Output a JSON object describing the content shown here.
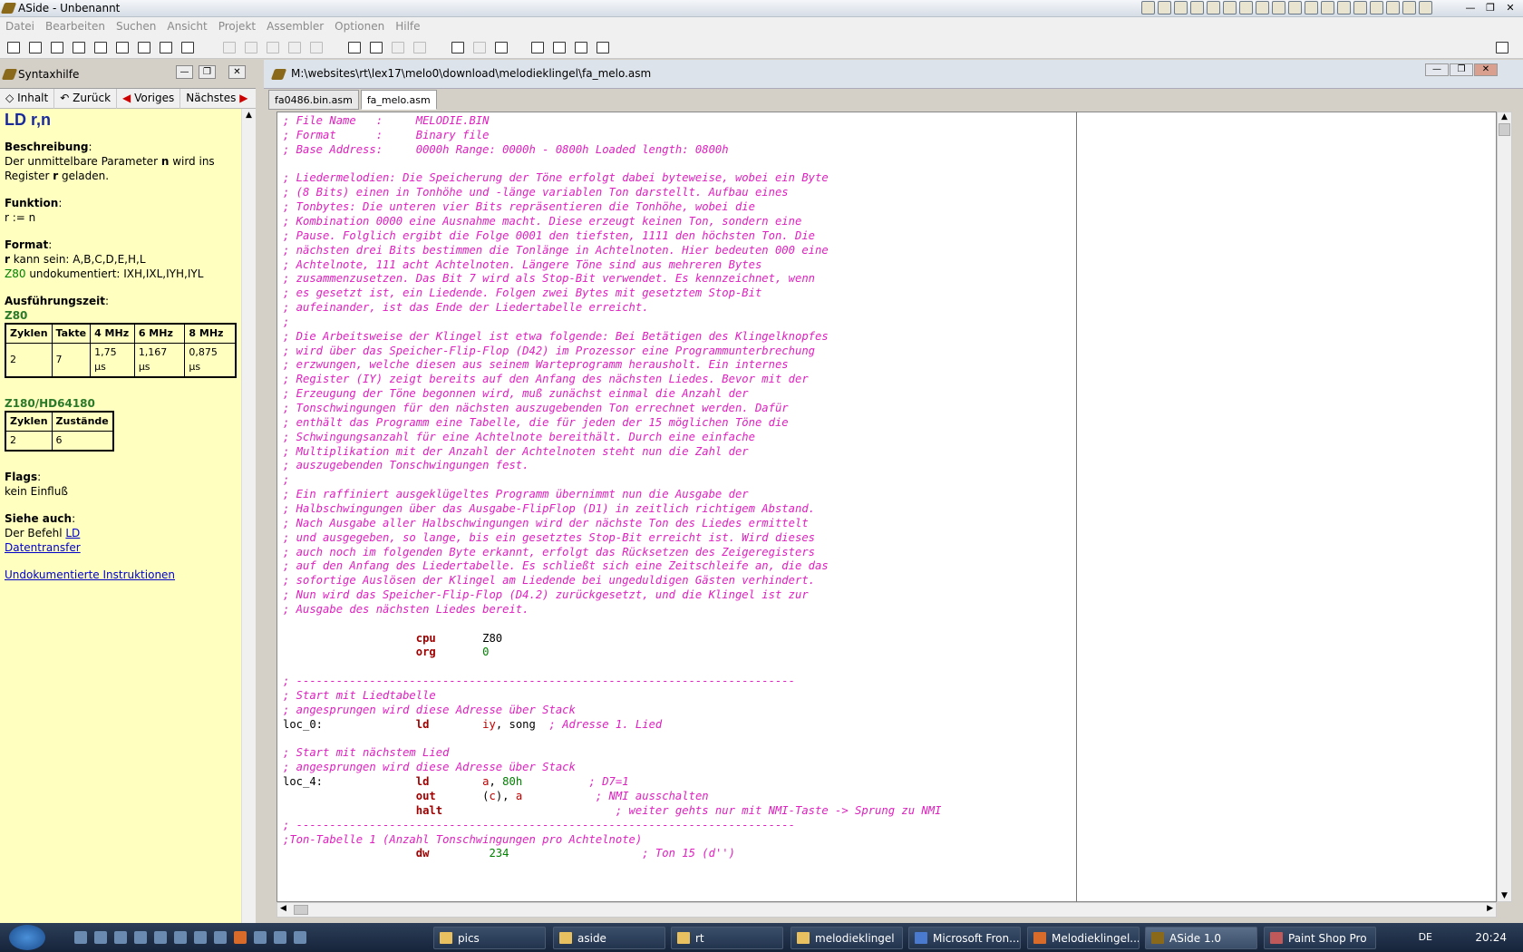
{
  "app": {
    "title": "ASide - Unbenannt"
  },
  "menu": [
    "Datei",
    "Bearbeiten",
    "Suchen",
    "Ansicht",
    "Projekt",
    "Assembler",
    "Optionen",
    "Hilfe"
  ],
  "help": {
    "title": "Syntaxhilfe",
    "nav": {
      "contents": "Inhalt",
      "back": "Zurück",
      "prev": "Voriges",
      "next": "Nächstes"
    },
    "cmd": "LD r,n",
    "desc_h": "Beschreibung",
    "desc_1a": "Der unmittelbare Parameter ",
    "desc_1b": "n",
    "desc_1c": " wird ins",
    "desc_2a": "Register ",
    "desc_2b": "r",
    "desc_2c": " geladen.",
    "func_h": "Funktion",
    "func": "r := n",
    "fmt_h": "Format",
    "fmt_1a": "r",
    "fmt_1b": " kann sein: A,B,C,D,E,H,L",
    "fmt_2a": "Z80",
    "fmt_2b": " undokumentiert: IXH,IXL,IYH,IYL",
    "time_h": "Ausführungszeit",
    "z80": "Z80",
    "z80_table": {
      "headers": [
        "Zyklen",
        "Takte",
        "4 MHz",
        "6 MHz",
        "8 MHz"
      ],
      "row": [
        "2",
        "7",
        "1,75 µs",
        "1,167 µs",
        "0,875 µs"
      ]
    },
    "z180": "Z180/HD64180",
    "z180_table": {
      "headers": [
        "Zyklen",
        "Zustände"
      ],
      "row": [
        "2",
        "6"
      ]
    },
    "flags_h": "Flags",
    "flags": "kein Einfluß",
    "see_h": "Siehe auch",
    "see_1a": "Der Befehl ",
    "see_1b": "LD",
    "see_2": "Datentransfer",
    "undoc": "Undokumentierte Instruktionen"
  },
  "editor": {
    "path": "M:\\websites\\rt\\lex17\\melo0\\download\\melodieklingel\\fa_melo.asm",
    "tabs": [
      "fa0486.bin.asm",
      "fa_melo.asm"
    ],
    "lines": [
      {
        "t": "c",
        "s": "; File Name   :     MELODIE.BIN"
      },
      {
        "t": "c",
        "s": "; Format      :     Binary file"
      },
      {
        "t": "c",
        "s": "; Base Address:     0000h Range: 0000h - 0800h Loaded length: 0800h"
      },
      {
        "t": "b",
        "s": ""
      },
      {
        "t": "c",
        "s": "; Liedermelodien: Die Speicherung der Töne erfolgt dabei byteweise, wobei ein Byte"
      },
      {
        "t": "c",
        "s": "; (8 Bits) einen in Tonhöhe und -länge variablen Ton darstellt. Aufbau eines"
      },
      {
        "t": "c",
        "s": "; Tonbytes: Die unteren vier Bits repräsentieren die Tonhöhe, wobei die"
      },
      {
        "t": "c",
        "s": "; Kombination 0000 eine Ausnahme macht. Diese erzeugt keinen Ton, sondern eine"
      },
      {
        "t": "c",
        "s": "; Pause. Folglich ergibt die Folge 0001 den tiefsten, 1111 den höchsten Ton. Die"
      },
      {
        "t": "c",
        "s": "; nächsten drei Bits bestimmen die Tonlänge in Achtelnoten. Hier bedeuten 000 eine"
      },
      {
        "t": "c",
        "s": "; Achtelnote, 111 acht Achtelnoten. Längere Töne sind aus mehreren Bytes"
      },
      {
        "t": "c",
        "s": "; zusammenzusetzen. Das Bit 7 wird als Stop-Bit verwendet. Es kennzeichnet, wenn"
      },
      {
        "t": "c",
        "s": "; es gesetzt ist, ein Liedende. Folgen zwei Bytes mit gesetztem Stop-Bit"
      },
      {
        "t": "c",
        "s": "; aufeinander, ist das Ende der Liedertabelle erreicht."
      },
      {
        "t": "c",
        "s": ";"
      },
      {
        "t": "c",
        "s": "; Die Arbeitsweise der Klingel ist etwa folgende: Bei Betätigen des Klingelknopfes"
      },
      {
        "t": "c",
        "s": "; wird über das Speicher-Flip-Flop (D42) im Prozessor eine Programmunterbrechung"
      },
      {
        "t": "c",
        "s": "; erzwungen, welche diesen aus seinem Warteprogramm herausholt. Ein internes"
      },
      {
        "t": "c",
        "s": "; Register (IY) zeigt bereits auf den Anfang des nächsten Liedes. Bevor mit der"
      },
      {
        "t": "c",
        "s": "; Erzeugung der Töne begonnen wird, muß zunächst einmal die Anzahl der"
      },
      {
        "t": "c",
        "s": "; Tonschwingungen für den nächsten auszugebenden Ton errechnet werden. Dafür"
      },
      {
        "t": "c",
        "s": "; enthält das Programm eine Tabelle, die für jeden der 15 möglichen Töne die"
      },
      {
        "t": "c",
        "s": "; Schwingungsanzahl für eine Achtelnote bereithält. Durch eine einfache"
      },
      {
        "t": "c",
        "s": "; Multiplikation mit der Anzahl der Achtelnoten steht nun die Zahl der"
      },
      {
        "t": "c",
        "s": "; auszugebenden Tonschwingungen fest."
      },
      {
        "t": "c",
        "s": ";"
      },
      {
        "t": "c",
        "s": "; Ein raffiniert ausgeklügeltes Programm übernimmt nun die Ausgabe der"
      },
      {
        "t": "c",
        "s": "; Halbschwingungen über das Ausgabe-FlipFlop (D1) in zeitlich richtigem Abstand."
      },
      {
        "t": "c",
        "s": "; Nach Ausgabe aller Halbschwingungen wird der nächste Ton des Liedes ermittelt"
      },
      {
        "t": "c",
        "s": "; und ausgegeben, so lange, bis ein gesetztes Stop-Bit erreicht ist. Wird dieses"
      },
      {
        "t": "c",
        "s": "; auch noch im folgenden Byte erkannt, erfolgt das Rücksetzen des Zeigeregisters"
      },
      {
        "t": "c",
        "s": "; auf den Anfang des Liedertabelle. Es schließt sich eine Zeitschleife an, die das"
      },
      {
        "t": "c",
        "s": "; sofortige Auslösen der Klingel am Liedende bei ungeduldigen Gästen verhindert."
      },
      {
        "t": "c",
        "s": "; Nun wird das Speicher-Flip-Flop (D4.2) zurückgesetzt, und die Klingel ist zur"
      },
      {
        "t": "c",
        "s": "; Ausgabe des nächsten Liedes bereit."
      },
      {
        "t": "b",
        "s": ""
      },
      {
        "t": "i",
        "label": "",
        "op": "cpu",
        "args": [
          {
            "k": "pl",
            "s": "Z80"
          }
        ],
        "cm": ""
      },
      {
        "t": "i",
        "label": "",
        "op": "org",
        "args": [
          {
            "k": "num",
            "s": "0"
          }
        ],
        "cm": ""
      },
      {
        "t": "b",
        "s": ""
      },
      {
        "t": "c",
        "s": "; ---------------------------------------------------------------------------"
      },
      {
        "t": "c",
        "s": "; Start mit Liedtabelle"
      },
      {
        "t": "c",
        "s": "; angesprungen wird diese Adresse über Stack"
      },
      {
        "t": "i",
        "label": "loc_0:",
        "op": "ld",
        "args": [
          {
            "k": "reg",
            "s": "iy"
          },
          {
            "k": "pl",
            "s": ", song"
          }
        ],
        "cm": "  ; Adresse 1. Lied"
      },
      {
        "t": "b",
        "s": ""
      },
      {
        "t": "c",
        "s": "; Start mit nächstem Lied"
      },
      {
        "t": "c",
        "s": "; angesprungen wird diese Adresse über Stack"
      },
      {
        "t": "i",
        "label": "loc_4:",
        "op": "ld",
        "args": [
          {
            "k": "reg",
            "s": "a"
          },
          {
            "k": "pl",
            "s": ", "
          },
          {
            "k": "num",
            "s": "80h"
          }
        ],
        "cm": "          ; D7=1"
      },
      {
        "t": "i",
        "label": "",
        "op": "out",
        "args": [
          {
            "k": "pl",
            "s": "("
          },
          {
            "k": "reg",
            "s": "c"
          },
          {
            "k": "pl",
            "s": "), "
          },
          {
            "k": "reg",
            "s": "a"
          }
        ],
        "cm": "           ; NMI ausschalten"
      },
      {
        "t": "i",
        "label": "",
        "op": "halt",
        "args": [],
        "cm": "                    ; weiter gehts nur mit NMI-Taste -> Sprung zu NMI"
      },
      {
        "t": "c",
        "s": "; ---------------------------------------------------------------------------"
      },
      {
        "t": "c",
        "s": ";Ton-Tabelle 1 (Anzahl Tonschwingungen pro Achtelnote)"
      },
      {
        "t": "i",
        "label": "",
        "op": "dw",
        "args": [
          {
            "k": "num",
            "s": " 234"
          }
        ],
        "cm": "                    ; Ton 15 (d'')"
      }
    ]
  },
  "taskbar": {
    "tasks": [
      {
        "label": "pics"
      },
      {
        "label": "aside"
      },
      {
        "label": "rt"
      },
      {
        "label": "melodieklingel"
      },
      {
        "label": "Microsoft Fron..."
      },
      {
        "label": "Melodieklingel..."
      },
      {
        "label": "ASide 1.0"
      },
      {
        "label": "Paint Shop Pro"
      }
    ],
    "lang": "DE",
    "clock": "20:24"
  }
}
